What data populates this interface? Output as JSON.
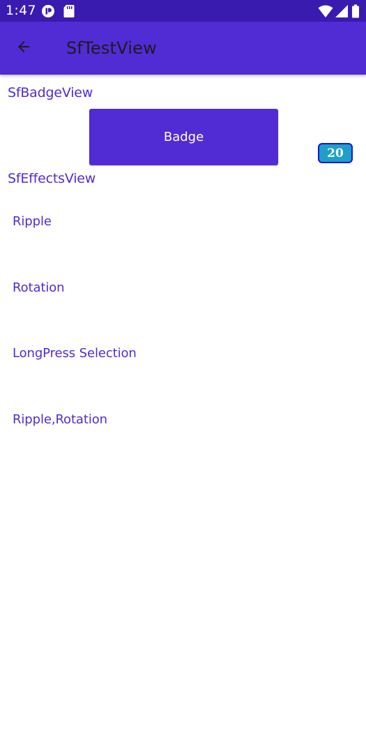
{
  "status_bar": {
    "time": "1:47",
    "left_icons": [
      "media-icon",
      "sd-card-icon"
    ],
    "right_icons": [
      "wifi-icon",
      "signal-icon",
      "battery-icon"
    ]
  },
  "app_bar": {
    "title": "SfTestView",
    "back_icon": "back-arrow-icon"
  },
  "badge_section": {
    "title": "SfBadgeView",
    "button_label": "Badge",
    "badge_count": "20"
  },
  "effects_section": {
    "title": "SfEffectsView",
    "items": [
      {
        "label": "Ripple"
      },
      {
        "label": "Rotation"
      },
      {
        "label": "LongPress Selection"
      },
      {
        "label": "Ripple,Rotation"
      }
    ]
  },
  "colors": {
    "status_bar": "#3a1bb0",
    "app_bar": "#512bd4",
    "accent": "#512bd4",
    "badge_fill": "#1e9fc8",
    "badge_border": "#1616d4"
  }
}
